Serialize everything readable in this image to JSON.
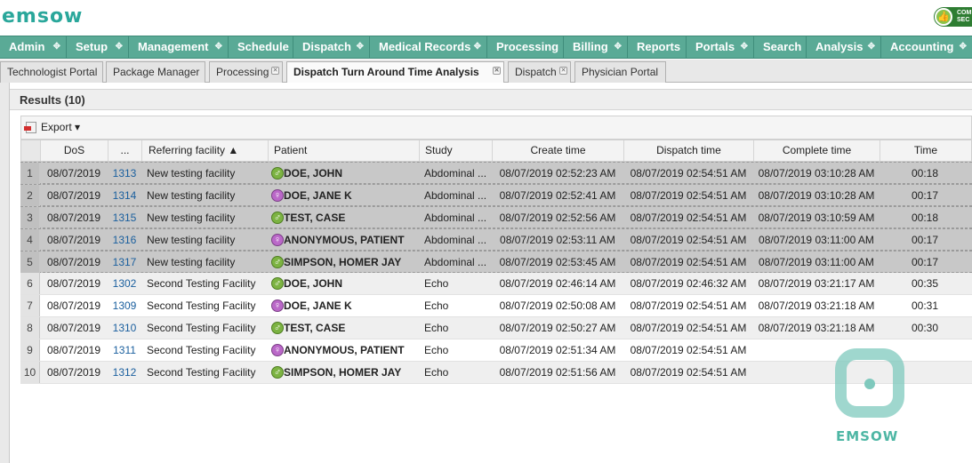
{
  "app": {
    "logo": "emsow",
    "badge_line1": "COM",
    "badge_line2": "SEC"
  },
  "menu": [
    {
      "label": "Admin"
    },
    {
      "label": "Setup"
    },
    {
      "label": "Management"
    },
    {
      "label": "Schedule"
    },
    {
      "label": "Dispatch"
    },
    {
      "label": "Medical Records"
    },
    {
      "label": "Processing"
    },
    {
      "label": "Billing"
    },
    {
      "label": "Reports"
    },
    {
      "label": "Portals"
    },
    {
      "label": "Search"
    },
    {
      "label": "Analysis"
    },
    {
      "label": "Accounting"
    }
  ],
  "tabs": [
    {
      "label": "Technologist Portal"
    },
    {
      "label": "Package Manager"
    },
    {
      "label": "Processing"
    },
    {
      "label": "Dispatch Turn Around Time Analysis"
    },
    {
      "label": "Dispatch"
    },
    {
      "label": "Physician Portal"
    }
  ],
  "results": {
    "title": "Results (10)",
    "export_label": "Export"
  },
  "columns": {
    "dos": "DoS",
    "acc": "...",
    "facility": "Referring facility ▲",
    "patient": "Patient",
    "study": "Study",
    "create": "Create time",
    "dispatch": "Dispatch time",
    "complete": "Complete time",
    "time": "Time"
  },
  "rows": [
    {
      "n": "1",
      "dos": "08/07/2019",
      "acc": "1313",
      "facility": "New testing facility",
      "sex": "male",
      "patient": "DOE, JOHN",
      "study": "Abdominal ...",
      "create": "08/07/2019 02:52:23 AM",
      "dispatch": "08/07/2019 02:54:51 AM",
      "complete": "08/07/2019 03:10:28 AM",
      "time": "00:18"
    },
    {
      "n": "2",
      "dos": "08/07/2019",
      "acc": "1314",
      "facility": "New testing facility",
      "sex": "female",
      "patient": "DOE, JANE K",
      "study": "Abdominal ...",
      "create": "08/07/2019 02:52:41 AM",
      "dispatch": "08/07/2019 02:54:51 AM",
      "complete": "08/07/2019 03:10:28 AM",
      "time": "00:17"
    },
    {
      "n": "3",
      "dos": "08/07/2019",
      "acc": "1315",
      "facility": "New testing facility",
      "sex": "male",
      "patient": "TEST, CASE",
      "study": "Abdominal ...",
      "create": "08/07/2019 02:52:56 AM",
      "dispatch": "08/07/2019 02:54:51 AM",
      "complete": "08/07/2019 03:10:59 AM",
      "time": "00:18"
    },
    {
      "n": "4",
      "dos": "08/07/2019",
      "acc": "1316",
      "facility": "New testing facility",
      "sex": "female",
      "patient": "ANONYMOUS, PATIENT",
      "study": "Abdominal ...",
      "create": "08/07/2019 02:53:11 AM",
      "dispatch": "08/07/2019 02:54:51 AM",
      "complete": "08/07/2019 03:11:00 AM",
      "time": "00:17"
    },
    {
      "n": "5",
      "dos": "08/07/2019",
      "acc": "1317",
      "facility": "New testing facility",
      "sex": "male",
      "patient": "SIMPSON, HOMER JAY",
      "study": "Abdominal ...",
      "create": "08/07/2019 02:53:45 AM",
      "dispatch": "08/07/2019 02:54:51 AM",
      "complete": "08/07/2019 03:11:00 AM",
      "time": "00:17"
    },
    {
      "n": "6",
      "dos": "08/07/2019",
      "acc": "1302",
      "facility": "Second Testing Facility",
      "sex": "male",
      "patient": "DOE, JOHN",
      "study": "Echo",
      "create": "08/07/2019 02:46:14 AM",
      "dispatch": "08/07/2019 02:46:32 AM",
      "complete": "08/07/2019 03:21:17 AM",
      "time": "00:35"
    },
    {
      "n": "7",
      "dos": "08/07/2019",
      "acc": "1309",
      "facility": "Second Testing Facility",
      "sex": "female",
      "patient": "DOE, JANE K",
      "study": "Echo",
      "create": "08/07/2019 02:50:08 AM",
      "dispatch": "08/07/2019 02:54:51 AM",
      "complete": "08/07/2019 03:21:18 AM",
      "time": "00:31"
    },
    {
      "n": "8",
      "dos": "08/07/2019",
      "acc": "1310",
      "facility": "Second Testing Facility",
      "sex": "male",
      "patient": "TEST, CASE",
      "study": "Echo",
      "create": "08/07/2019 02:50:27 AM",
      "dispatch": "08/07/2019 02:54:51 AM",
      "complete": "08/07/2019 03:21:18 AM",
      "time": "00:30"
    },
    {
      "n": "9",
      "dos": "08/07/2019",
      "acc": "1311",
      "facility": "Second Testing Facility",
      "sex": "female",
      "patient": "ANONYMOUS, PATIENT",
      "study": "Echo",
      "create": "08/07/2019 02:51:34 AM",
      "dispatch": "08/07/2019 02:54:51 AM",
      "complete": "",
      "time": ""
    },
    {
      "n": "10",
      "dos": "08/07/2019",
      "acc": "1312",
      "facility": "Second Testing Facility",
      "sex": "male",
      "patient": "SIMPSON, HOMER JAY",
      "study": "Echo",
      "create": "08/07/2019 02:51:56 AM",
      "dispatch": "08/07/2019 02:54:51 AM",
      "complete": "",
      "time": ""
    }
  ],
  "watermark": {
    "text": "EMSOW"
  }
}
